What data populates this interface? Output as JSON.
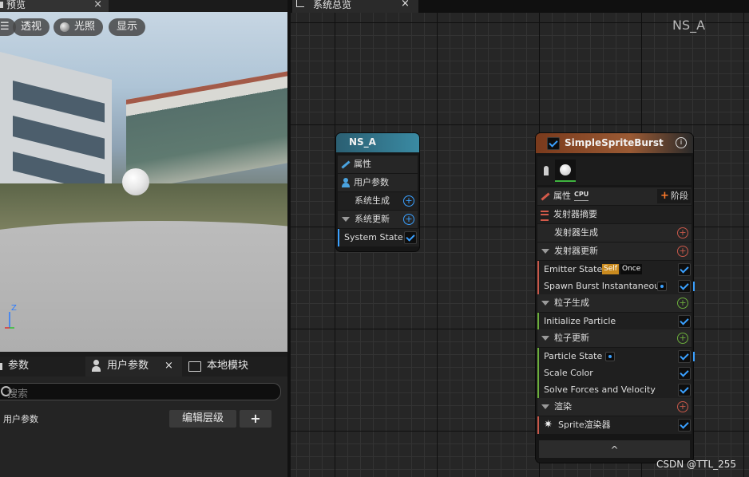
{
  "preview": {
    "tab_title": "预览",
    "close": "×",
    "viewport_buttons": {
      "menu": "☰",
      "perspective": "透视",
      "lighting": "光照",
      "show": "显示"
    },
    "gizmo_z": "Z"
  },
  "params_panel": {
    "tabs": {
      "params": "参数",
      "user_params": "用户参数",
      "local_modules": "本地模块"
    },
    "close": "×",
    "search_placeholder": "搜索",
    "row_label": "用户参数",
    "edit_hierarchy": "编辑层级",
    "add": "+"
  },
  "graph": {
    "tab_title": "系统总览",
    "close": "×",
    "system_name": "NS_A",
    "watermark": "CSDN @TTL_255"
  },
  "system_node": {
    "title": "NS_A",
    "rows": {
      "properties": "属性",
      "user_params": "用户参数",
      "system_spawn": "系统生成",
      "system_update": "系统更新",
      "system_state": "System State"
    }
  },
  "emitter_node": {
    "title": "SimpleSpriteBurst",
    "info": "i",
    "properties": "属性",
    "sim_target": "CPU",
    "stage_button": "阶段",
    "emitter_summary": "发射器摘要",
    "emitter_spawn": "发射器生成",
    "emitter_update": "发射器更新",
    "emitter_state": "Emitter State",
    "badge_self": "Self",
    "badge_once": "Once",
    "spawn_burst": "Spawn Burst Instantaneous",
    "particle_spawn": "粒子生成",
    "initialize_particle": "Initialize Particle",
    "particle_update": "粒子更新",
    "particle_state": "Particle State",
    "scale_color": "Scale Color",
    "solve_forces": "Solve Forces and Velocity",
    "render": "渲染",
    "sprite_renderer": "Sprite渲染器",
    "collapse": "^"
  },
  "colors": {
    "system_header": "#2a6f82",
    "emitter_header": "#8a4a24",
    "accent_blue": "#3aa0ff",
    "emitter_plus": "#c8584a",
    "particle_plus": "#6cae3c",
    "render_plus": "#c8584a"
  }
}
